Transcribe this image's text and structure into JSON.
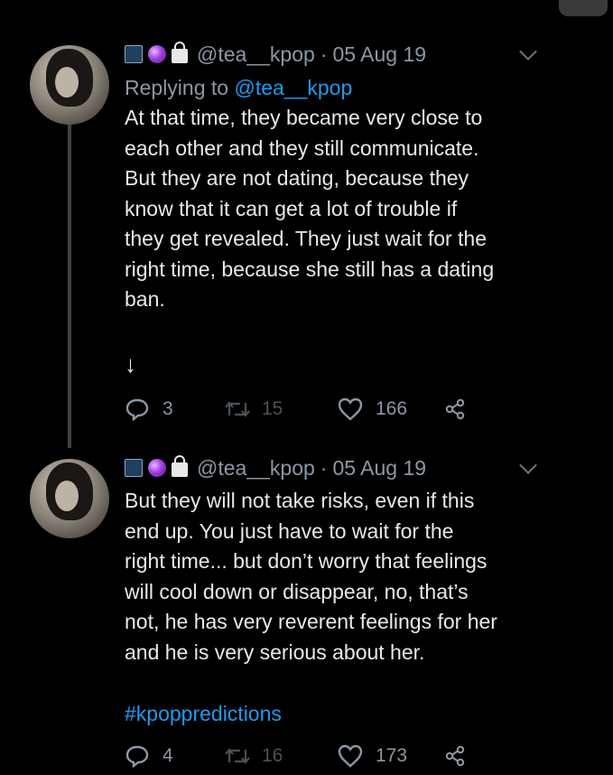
{
  "tweets": [
    {
      "handle": "@tea__kpop",
      "separator": "·",
      "date": "05 Aug 19",
      "replying_prefix": "Replying to ",
      "replying_to": "@tea__kpop",
      "body": "At that time, they became very close to\neach other and they still communicate.\nBut they are not dating, because they\nknow that it can get a lot of trouble if\nthey get revealed. They just wait for the\nright time, because she still has a dating\nban.",
      "arrow": "↓",
      "replies": "3",
      "retweets": "15",
      "likes": "166"
    },
    {
      "handle": "@tea__kpop",
      "separator": "·",
      "date": "05 Aug 19",
      "body": "But they will not take risks, even if this\nend up. You just have to wait for the\nright time... but don’t worry that feelings\nwill cool down or disappear, no, that’s\nnot, he has very reverent feelings for her\nand he is very serious about her.",
      "hashtag": "#kpoppredictions",
      "replies": "4",
      "retweets": "16",
      "likes": "173"
    }
  ],
  "colors": {
    "background": "#000000",
    "text": "#e7e9ea",
    "muted": "#8b98a5",
    "link": "#1d9bf0",
    "thread_line": "#3d4449"
  }
}
